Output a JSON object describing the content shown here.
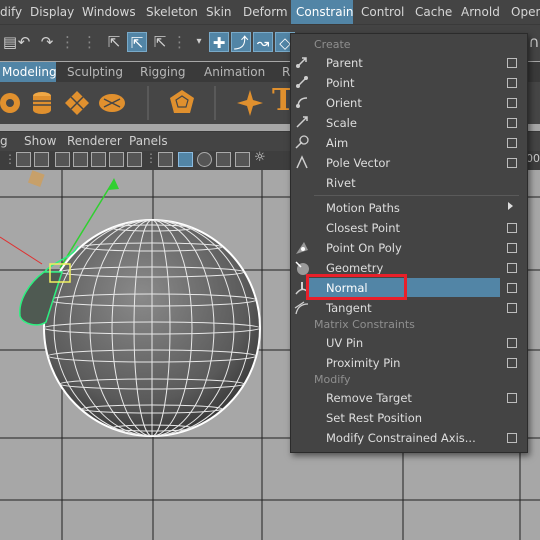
{
  "menubar": {
    "items": [
      {
        "label": "dify"
      },
      {
        "label": "Display"
      },
      {
        "label": "Windows"
      },
      {
        "label": "Skeleton"
      },
      {
        "label": "Skin"
      },
      {
        "label": "Deform"
      },
      {
        "label": "Constrain"
      },
      {
        "label": "Control"
      },
      {
        "label": "Cache"
      },
      {
        "label": "Arnold"
      },
      {
        "label": "Open"
      }
    ]
  },
  "shelf": {
    "tabs": [
      {
        "label": "Modeling"
      },
      {
        "label": "Sculpting"
      },
      {
        "label": "Rigging"
      },
      {
        "label": "Animation"
      },
      {
        "label": "R"
      }
    ]
  },
  "panel_menu": {
    "items": [
      {
        "label": "g"
      },
      {
        "label": "Show"
      },
      {
        "label": "Renderer"
      },
      {
        "label": "Panels"
      }
    ],
    "partial_value": "00"
  },
  "constrain_menu": {
    "sections": {
      "create": "Create",
      "matrix": "Matrix Constraints",
      "modify": "Modify"
    },
    "items": [
      {
        "label": "Parent"
      },
      {
        "label": "Point"
      },
      {
        "label": "Orient"
      },
      {
        "label": "Scale"
      },
      {
        "label": "Aim"
      },
      {
        "label": "Pole Vector"
      },
      {
        "label": "Rivet"
      },
      {
        "label": "Motion Paths"
      },
      {
        "label": "Closest Point"
      },
      {
        "label": "Point On Poly"
      },
      {
        "label": "Geometry"
      },
      {
        "label": "Normal"
      },
      {
        "label": "Tangent"
      },
      {
        "label": "UV Pin"
      },
      {
        "label": "Proximity Pin"
      },
      {
        "label": "Remove Target"
      },
      {
        "label": "Set Rest Position"
      },
      {
        "label": "Modify Constrained Axis..."
      }
    ],
    "highlighted": "Normal"
  },
  "colors": {
    "menu_bg": "#444444",
    "accent": "#5285a6",
    "viewport_bg": "#a7a7a7",
    "callout": "#e8202a"
  }
}
